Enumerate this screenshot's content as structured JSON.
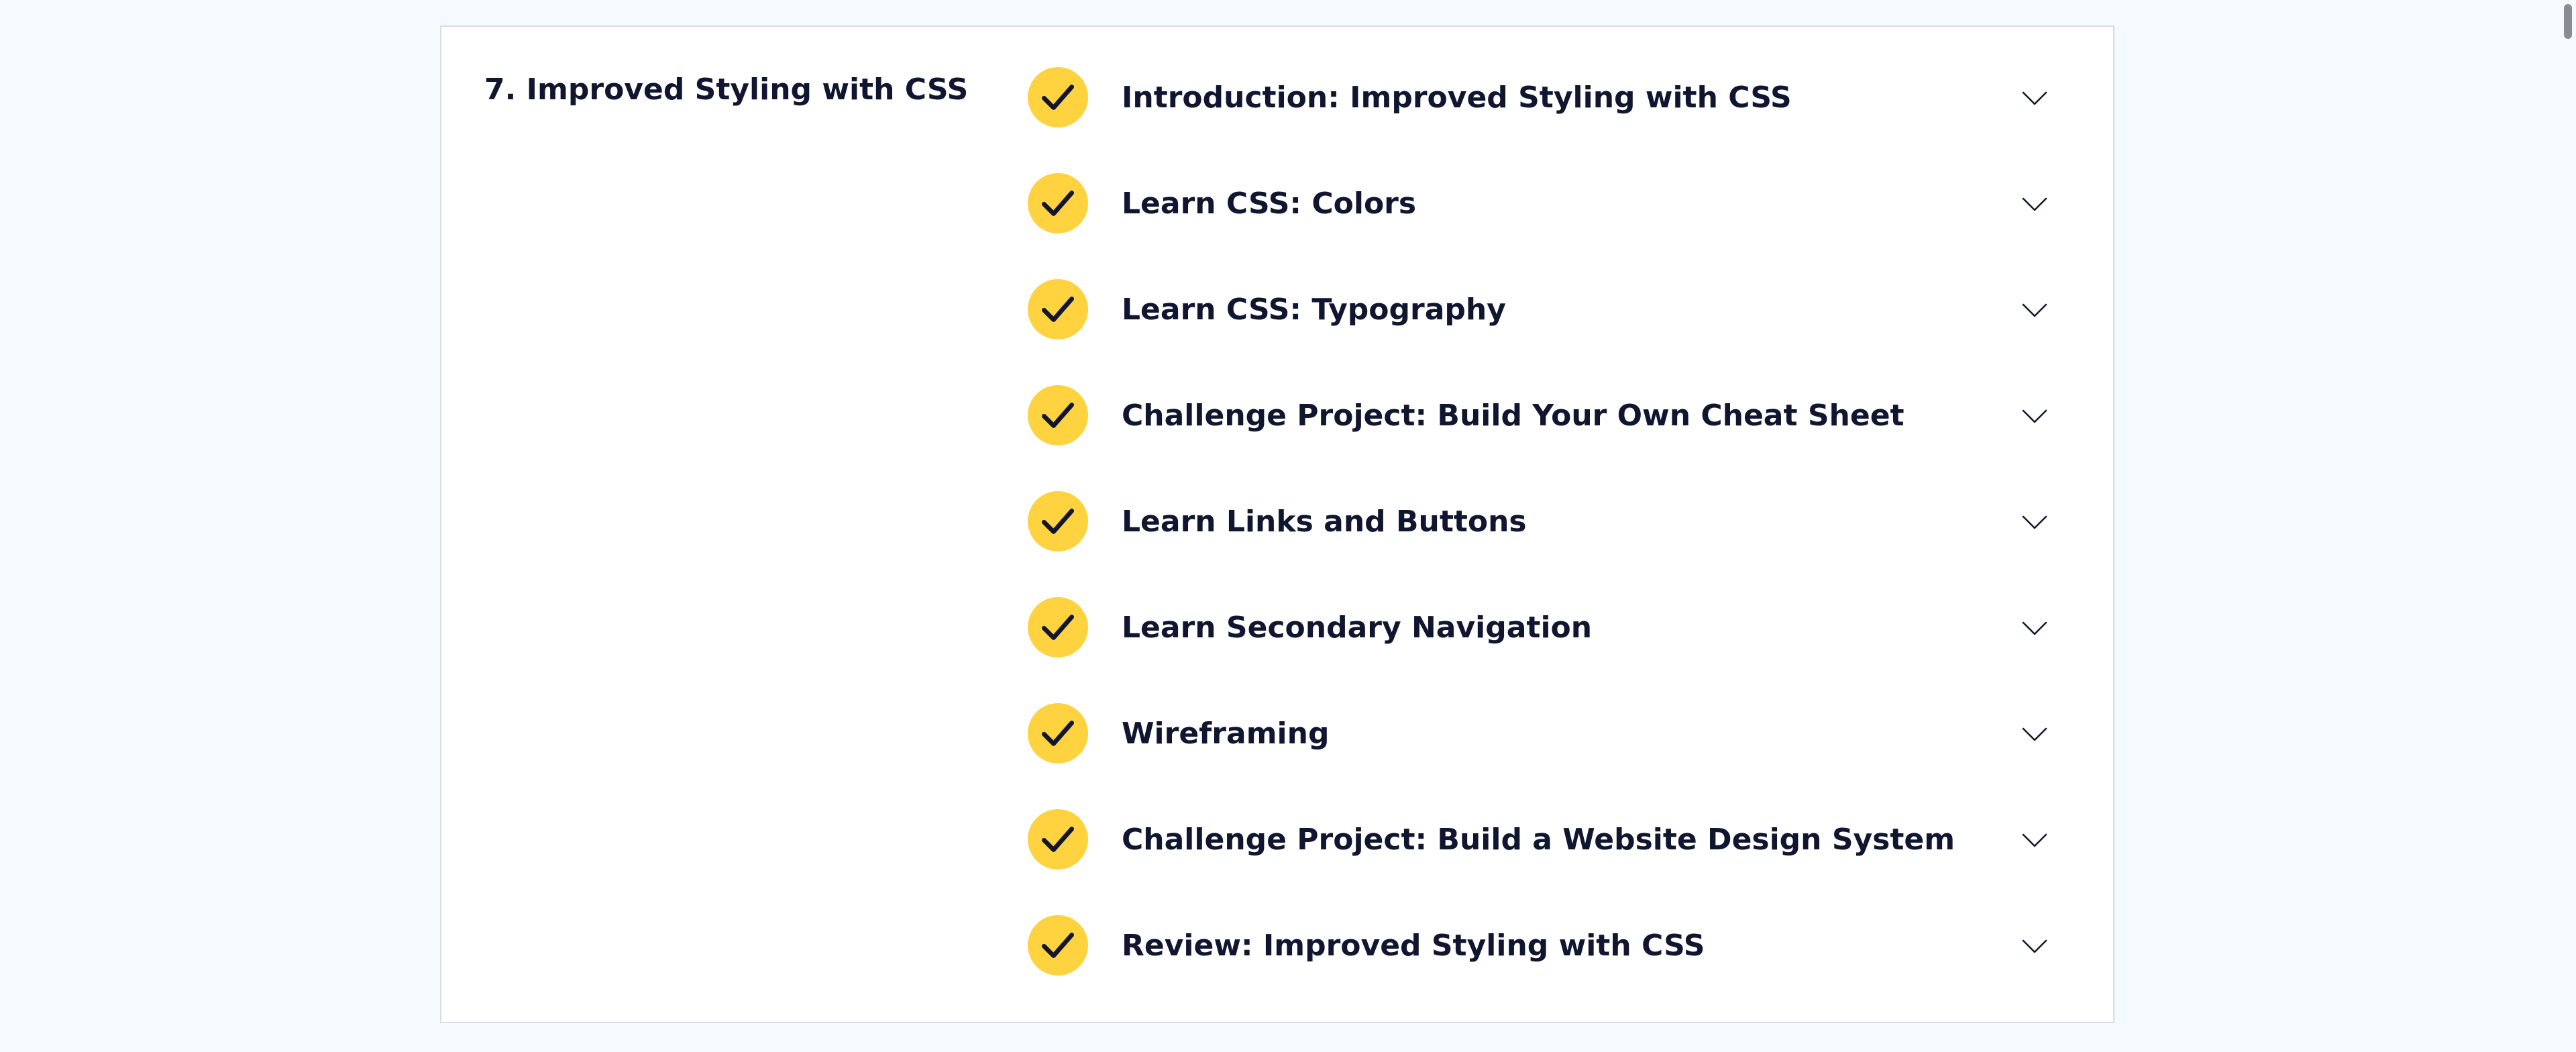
{
  "section": {
    "title": "7. Improved Styling with CSS"
  },
  "lessons": [
    {
      "label": "Introduction: Improved Styling with CSS",
      "completed": true
    },
    {
      "label": "Learn CSS: Colors",
      "completed": true
    },
    {
      "label": "Learn CSS: Typography",
      "completed": true
    },
    {
      "label": "Challenge Project: Build Your Own Cheat Sheet",
      "completed": true
    },
    {
      "label": "Learn Links and Buttons",
      "completed": true
    },
    {
      "label": "Learn Secondary Navigation",
      "completed": true
    },
    {
      "label": "Wireframing",
      "completed": true
    },
    {
      "label": "Challenge Project: Build a Website Design System",
      "completed": true
    },
    {
      "label": "Review: Improved Styling with CSS",
      "completed": true
    }
  ],
  "icons": {
    "completed": "checkmark-icon",
    "expand": "chevron-down-icon"
  },
  "colors": {
    "page_background": "#f4fafd",
    "badge": "#ffd23f",
    "text": "#10162f",
    "card_border": "#d9dde3"
  }
}
